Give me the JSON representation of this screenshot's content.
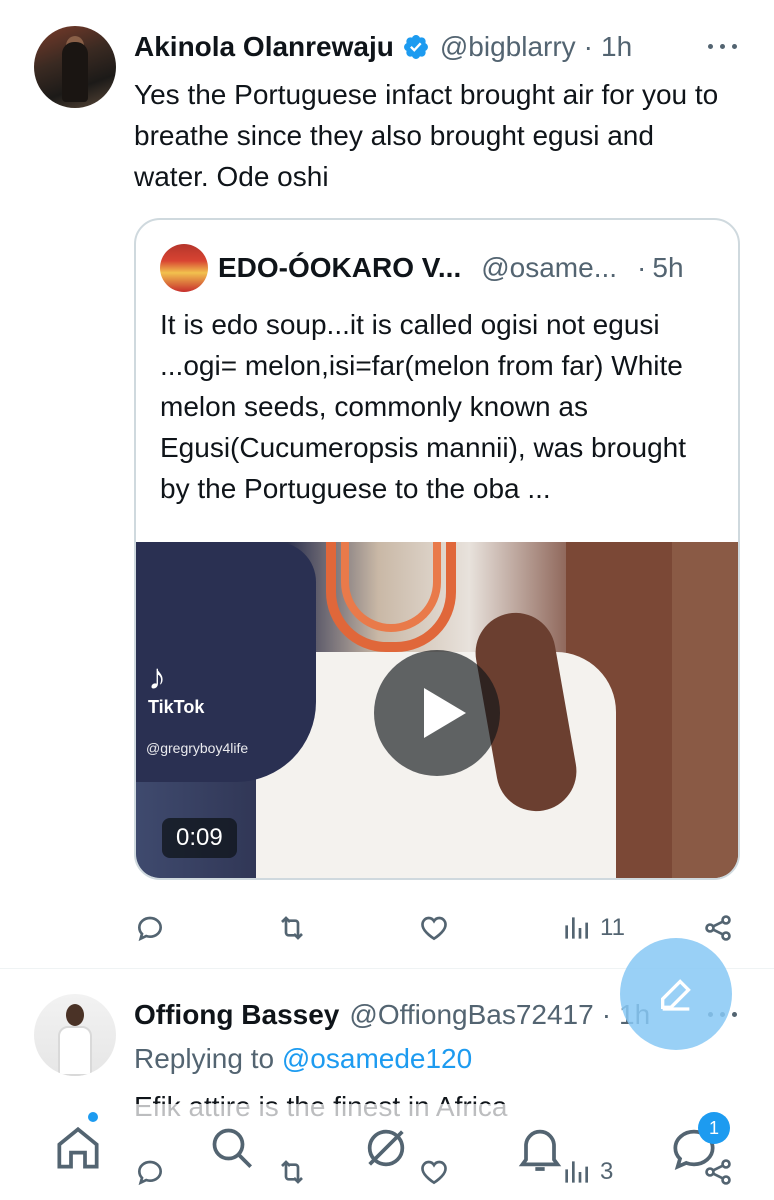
{
  "tweet1": {
    "name": "Akinola Olanrewaju",
    "handle": "@bigblarry",
    "separator": "·",
    "time": "1h",
    "text": "Yes the Portuguese infact brought air for you to breathe since they also brought egusi and water. Ode oshi",
    "quote": {
      "name": "EDO-ÓOKARO V...",
      "handle": "@osame...",
      "separator": "·",
      "time": "5h",
      "text": "It is edo soup...it is called ogisi not egusi ...ogi= melon,isi=far(melon from far) White melon seeds, commonly known as Egusi(Cucumeropsis mannii), was brought by the Portuguese to the oba ...",
      "video": {
        "watermark": "TikTok",
        "watermark_user": "@gregryboy4life",
        "duration": "0:09"
      }
    },
    "actions": {
      "views": "11"
    }
  },
  "tweet2": {
    "name": "Offiong Bassey",
    "handle": "@OffiongBas72417",
    "separator": "·",
    "time": "1h",
    "replying_prefix": "Replying to ",
    "replying_to": "@osamede120",
    "text": "Efik attire is the finest in Africa",
    "actions": {
      "views": "3"
    }
  },
  "nav": {
    "notifications_badge": "1"
  },
  "colors": {
    "accent": "#1d9bf0",
    "secondary_text": "#536471",
    "border": "#cfd9de"
  }
}
